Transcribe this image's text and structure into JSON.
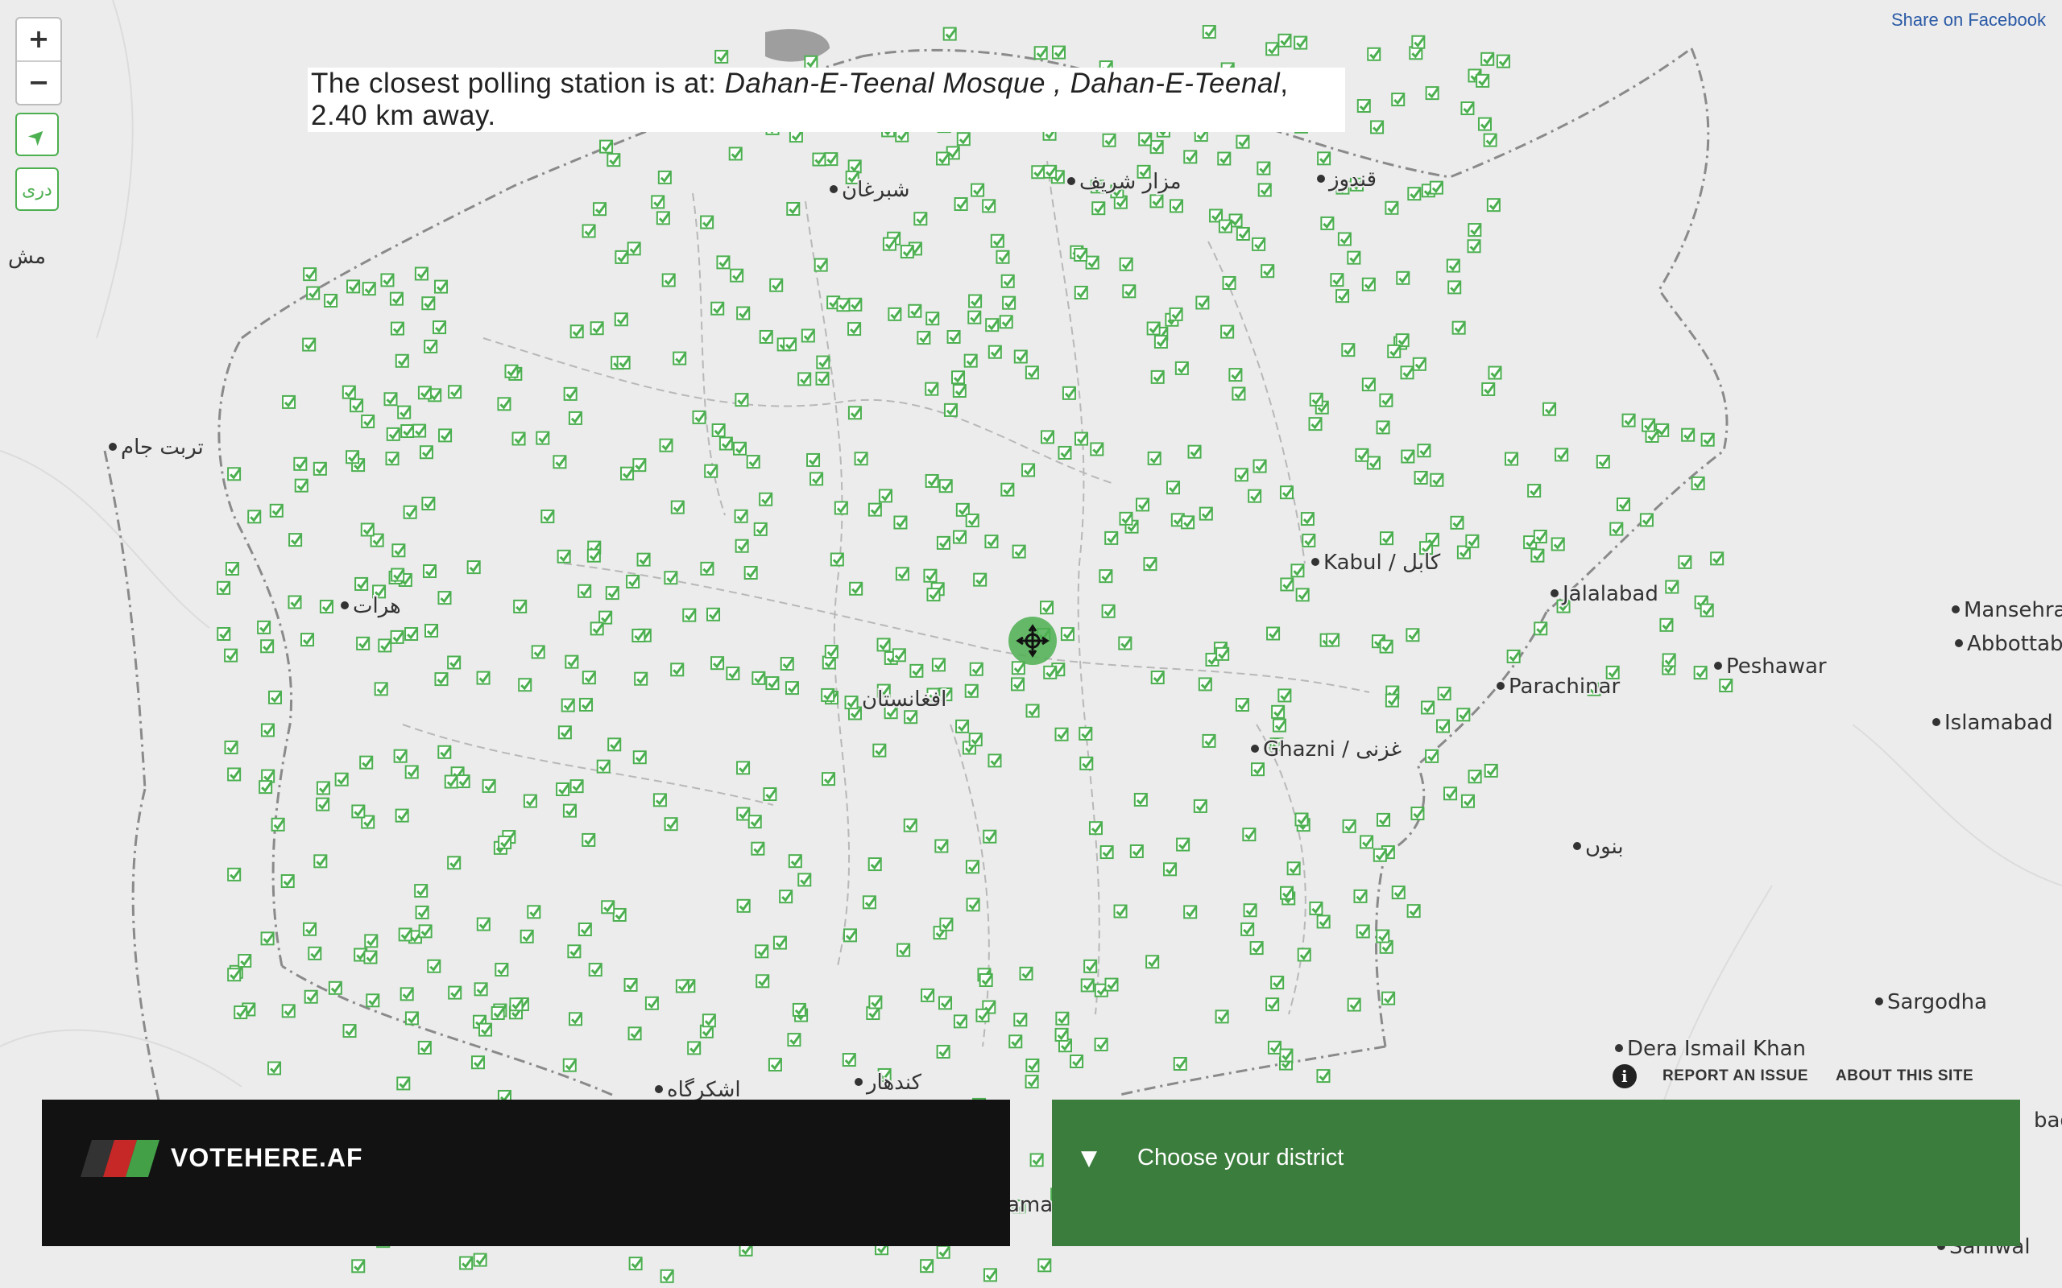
{
  "controls": {
    "zoom_in": "+",
    "zoom_out": "−",
    "locate_icon": "➤",
    "language_toggle": "دری"
  },
  "share": {
    "facebook_label": "Share on Facebook"
  },
  "result": {
    "prefix": "The closest polling station is at: ",
    "station": "Dahan-E-Teenal Mosque , Dahan-E-Teenal",
    "suffix": ", 2.40 km away."
  },
  "map": {
    "places": [
      "مزار شريف",
      "شبرغان",
      "قندوز",
      "تربت جام",
      "هرات",
      "افغانستان",
      "Kabul / كابل",
      "Jalalabad",
      "Ghazni / غزنی",
      "Parachinar",
      "بنوں",
      "Mansehra",
      "Abbottab",
      "Peshawar",
      "Islamabad",
      "Sargodha",
      "Dera Ismail Khan",
      "اشکرگاه",
      "کندهار",
      "مش",
      "ama",
      "bad",
      "Sahiwal"
    ],
    "station_icon": "check-box-icon",
    "station_color": "#4caf50",
    "selected_icon": "move-crosshair-icon"
  },
  "footer_links": {
    "info_icon": "i",
    "report": "REPORT AN ISSUE",
    "about": "ABOUT THIS SITE"
  },
  "brand": {
    "name": "VOTEHERE.AF",
    "flag_colors": [
      "#333333",
      "#c62828",
      "#43a047"
    ]
  },
  "district": {
    "arrow": "▼",
    "label": "Choose your district"
  },
  "colors": {
    "accent": "#3b7d3c",
    "panel_dark": "#121212",
    "map_bg": "#ececec"
  }
}
